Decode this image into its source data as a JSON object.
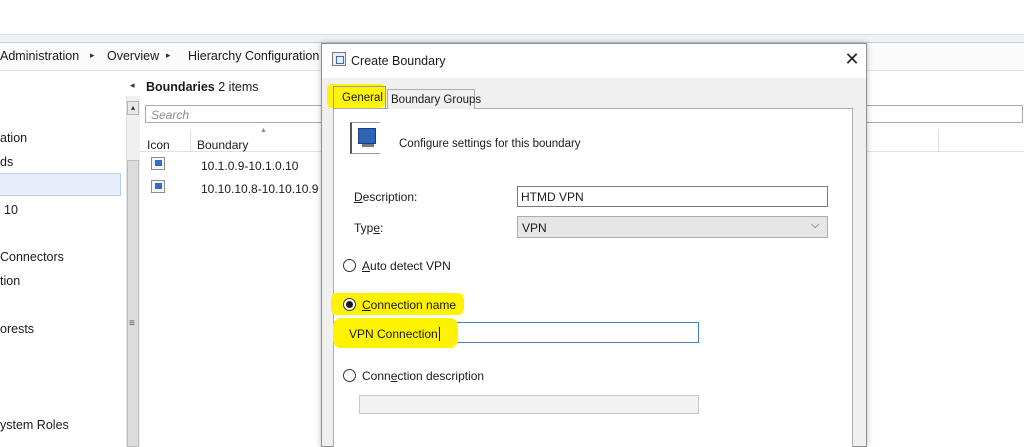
{
  "breadcrumb": {
    "items": [
      "Administration",
      "Overview",
      "Hierarchy Configuration"
    ],
    "separator": "▸"
  },
  "nav": {
    "items": [
      "ation",
      "ds",
      "10",
      "Connectors",
      "tion",
      "orests",
      "ystem Roles"
    ],
    "collapse_glyph": "◂",
    "scroll_up_glyph": "▴",
    "grip_glyph": "≡"
  },
  "list": {
    "title_bold": "Boundaries",
    "title_count": "2 items",
    "search_placeholder": "Search",
    "columns": [
      "Icon",
      "Boundary"
    ],
    "sort_glyph": "▲",
    "rows": [
      {
        "icon": "boundary-icon",
        "boundary": "10.1.0.9-10.1.0.10"
      },
      {
        "icon": "boundary-icon",
        "boundary": "10.10.10.8-10.10.10.9"
      }
    ]
  },
  "dialog": {
    "title": "Create Boundary",
    "close_glyph": "✕",
    "tabs": [
      "General",
      "Boundary Groups"
    ],
    "active_tab": "General",
    "header_text": "Configure settings for this boundary",
    "description_label_u": "D",
    "description_label_rest": "escription:",
    "description_value": "HTMD VPN",
    "type_label_pre": "Typ",
    "type_label_u": "e",
    "type_label_post": ":",
    "type_value": "VPN",
    "type_chevron": "⌵",
    "radio_auto_u": "A",
    "radio_auto_rest": "uto detect VPN",
    "radio_conn_u": "C",
    "radio_conn_rest": "onnection name",
    "connection_name_value": "VPN Connection",
    "radio_desc_pre": "Conn",
    "radio_desc_u": "e",
    "radio_desc_post": "ction description",
    "selected_radio": "connection-name",
    "highlight_color": "#fff200"
  }
}
